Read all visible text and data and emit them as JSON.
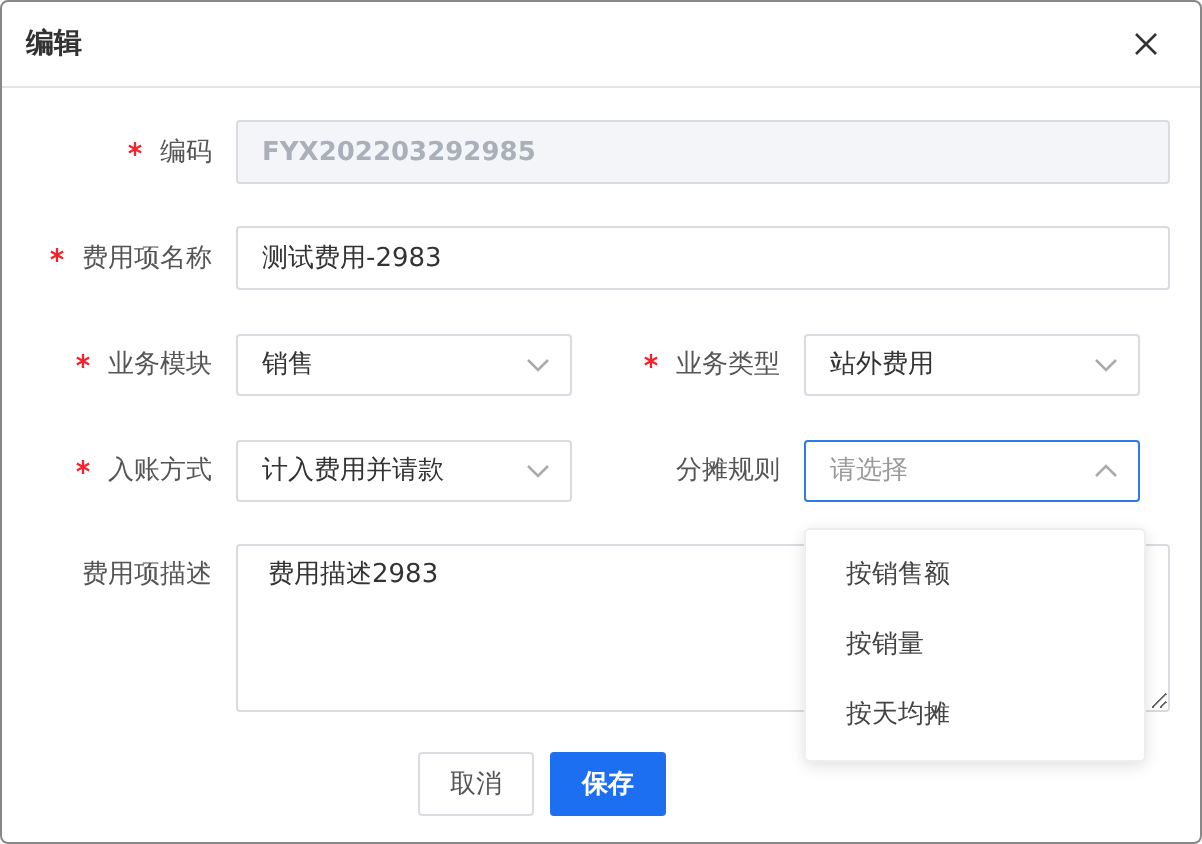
{
  "dialog": {
    "title": "编辑"
  },
  "rows": [
    [
      {
        "label": "编码",
        "required": true,
        "kind": "text",
        "value": "FYX202203292985",
        "disabled": true
      }
    ],
    [
      {
        "label": "费用项名称",
        "required": true,
        "kind": "text",
        "value": "测试费用-2983",
        "disabled": false
      }
    ],
    [
      {
        "label": "业务模块",
        "required": true,
        "kind": "select",
        "value": "销售",
        "expanded": false
      },
      {
        "label": "业务类型",
        "required": true,
        "kind": "select",
        "value": "站外费用",
        "expanded": false
      }
    ],
    [
      {
        "label": "入账方式",
        "required": true,
        "kind": "select",
        "value": "计入费用并请款",
        "expanded": false
      },
      {
        "label": "分摊规则",
        "required": false,
        "kind": "select",
        "placeholder": "请选择",
        "expanded": true,
        "options": [
          "按销售额",
          "按销量",
          "按天均摊"
        ]
      }
    ],
    [
      {
        "label": "费用项描述",
        "required": false,
        "kind": "textarea",
        "value": "费用描述2983"
      }
    ]
  ],
  "buttons": [
    {
      "label": "取消",
      "kind": "default"
    },
    {
      "label": "保存",
      "kind": "primary"
    }
  ]
}
